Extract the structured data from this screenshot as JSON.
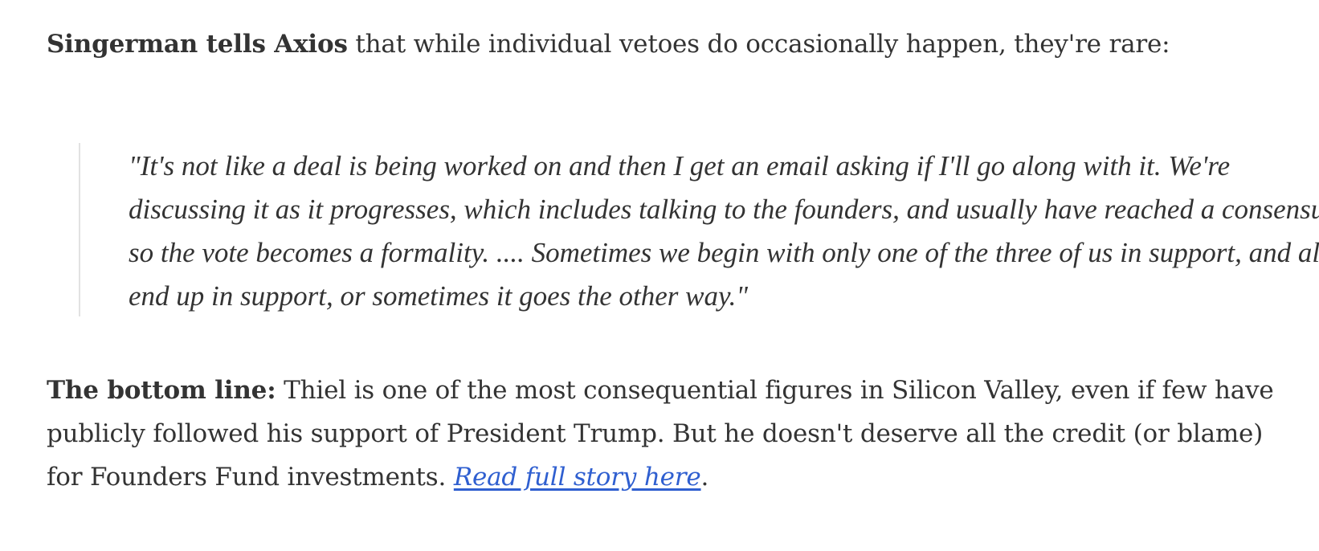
{
  "intro": {
    "lead": "Singerman tells Axios",
    "text": " that while individual vetoes do occasionally happen, they're rare:"
  },
  "quote": {
    "text": "\"It's not like a deal is being worked on and then I get an email asking if I'll go along with it. We're discussing it as it progresses, which includes talking to the founders, and usually have reached a consensus so the vote becomes a formality. .... Sometimes we begin with only one of the three of us in support, and all end up in support, or sometimes it goes the other way.\""
  },
  "bottom_line": {
    "lead": "The bottom line:",
    "text": " Thiel is one of the most consequential figures in Silicon Valley, even if few have publicly followed his support of President Trump. But he doesn't deserve all the credit (or blame) for Founders Fund investments. ",
    "link_text": "Read full story here",
    "trailing": "."
  },
  "colors": {
    "text": "#333333",
    "link": "#2f5fd0",
    "quote_border": "#e2e2e2",
    "background": "#ffffff"
  }
}
